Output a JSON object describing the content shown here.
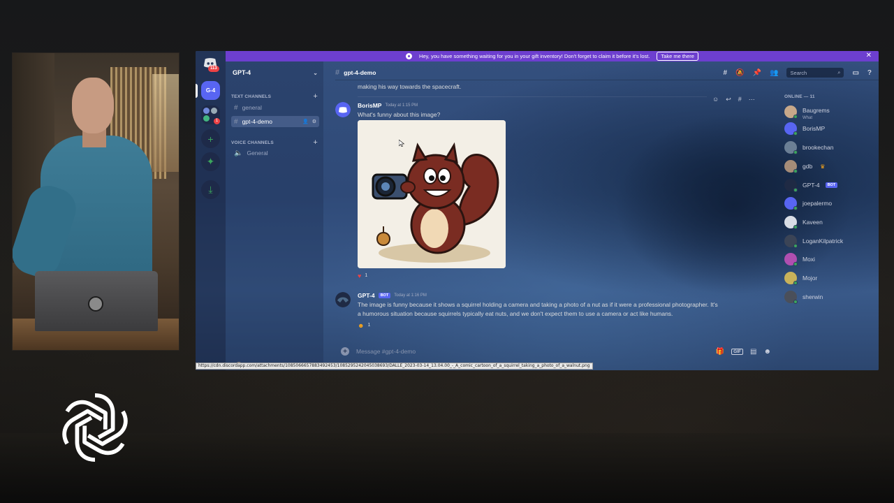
{
  "notice": {
    "text": "Hey, you have something waiting for you in your gift inventory! Don't forget to claim it before it's lost.",
    "button": "Take me there"
  },
  "rail": {
    "badge": "113",
    "server_label": "G-4",
    "folder_badge": "1"
  },
  "sidebar": {
    "server_name": "GPT-4",
    "text_category": "TEXT CHANNELS",
    "voice_category": "VOICE CHANNELS",
    "text_channels": [
      "general",
      "gpt-4-demo"
    ],
    "voice_channels": [
      "General"
    ],
    "user_name": "gdb"
  },
  "header": {
    "channel": "gpt-4-demo",
    "search_placeholder": "Search"
  },
  "messages": {
    "previous_text": "making his way towards the spacecraft.",
    "first": {
      "author": "BorisMP",
      "time": "Today at 1:15 PM",
      "text": "What's funny about this image?",
      "reaction_count": "1"
    },
    "second": {
      "author": "GPT-4",
      "bot_tag": "BOT",
      "time": "Today at 1:16 PM",
      "text_line1": "The image is funny because it shows a squirrel holding a camera and taking a photo of a nut as if it were a professional photographer. It's",
      "text_line2": "a humorous situation because squirrels typically eat nuts, and we don't expect them to use a camera or act like humans.",
      "reaction_count": "1"
    }
  },
  "composer": {
    "placeholder": "Message #gpt-4-demo",
    "gif_label": "GIF"
  },
  "members": {
    "title": "ONLINE — 11",
    "list": [
      {
        "name": "Baugrems",
        "status": "What"
      },
      {
        "name": "BorisMP"
      },
      {
        "name": "brookechan"
      },
      {
        "name": "gdb"
      },
      {
        "name": "GPT-4",
        "tag": "BOT"
      },
      {
        "name": "joepalermo"
      },
      {
        "name": "Kaveen"
      },
      {
        "name": "LoganKilpatrick"
      },
      {
        "name": "Moxi"
      },
      {
        "name": "Mojor"
      },
      {
        "name": "sherwin"
      }
    ]
  },
  "status_url": "https://cdn.discordapp.com/attachments/1085066657883492453/1085295242045038693/DALLE_2023-03-14_13.04.00_-_A_comic_cartoon_of_a_squirrel_taking_a_photo_of_a_walnut.png",
  "colors": {
    "accent": "#5865f2",
    "notice_bg": "#6d3fcf",
    "online": "#3ba55d",
    "danger": "#ed4245"
  }
}
